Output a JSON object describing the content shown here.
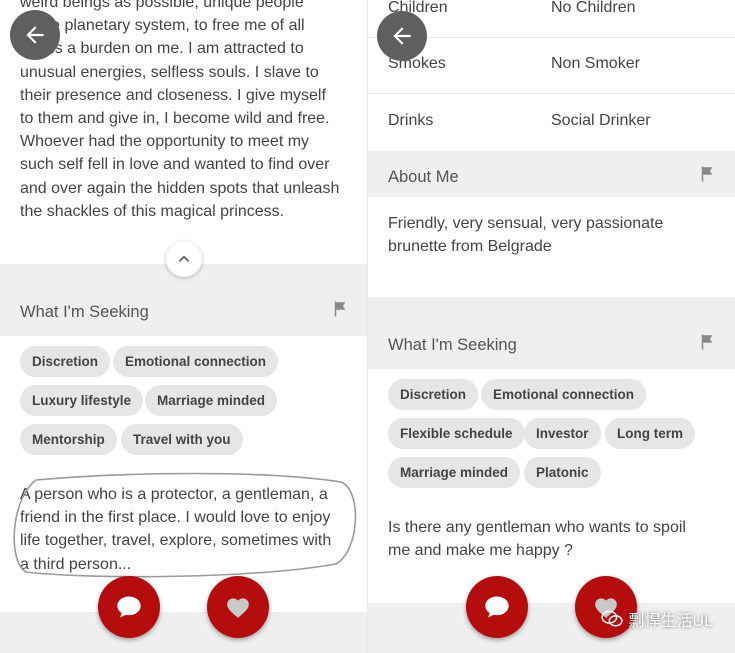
{
  "left": {
    "bio_lines": [
      "weird beings as possible, unique people",
      "of the planetary system, to free me of all",
      "that is a burden on me.  I am attracted to",
      "unusual energies, selfless souls.  I slave to",
      "their presence and closeness.  I give myself",
      "to them and give in, I become wild and free.",
      "Whoever had the opportunity to meet my",
      "such self fell in love and wanted to find over",
      "and over again the hidden spots that unleash",
      "the shackles of this magical princess."
    ],
    "seeking_title": "What I'm Seeking",
    "tags": [
      "Discretion",
      "Emotional connection",
      "Luxury lifestyle",
      "Marriage minded",
      "Mentorship",
      "Travel with you"
    ],
    "seeking_text_lines": [
      "A person who is a protector, a gentleman, a",
      "friend in the first place.  I would love to enjoy",
      "life together, travel, explore, sometimes with",
      "a third person..."
    ]
  },
  "right": {
    "details": [
      {
        "label": "Children",
        "value": "No Children"
      },
      {
        "label": "Smokes",
        "value": "Non Smoker"
      },
      {
        "label": "Drinks",
        "value": "Social Drinker"
      }
    ],
    "about_title": "About Me",
    "about_lines": [
      "Friendly, very sensual, very passionate",
      "brunette from Belgrade"
    ],
    "seeking_title": "What I'm Seeking",
    "tags": [
      "Discretion",
      "Emotional connection",
      "Flexible schedule",
      "Investor",
      "Long term",
      "Marriage minded",
      "Platonic"
    ],
    "seeking_text_lines": [
      "Is there any gentleman who wants to spoil",
      "me and make me happy ?"
    ]
  },
  "icons": {
    "back": "arrow-left-icon",
    "expand": "chevron-up-icon",
    "flag": "flag-icon",
    "message": "chat-bubble-icon",
    "favorite": "heart-icon"
  },
  "colors": {
    "accent": "#b50d0d",
    "tag_bg": "#e6e6e6",
    "band_bg": "#efefef"
  },
  "watermark": "剽悍生活UL"
}
